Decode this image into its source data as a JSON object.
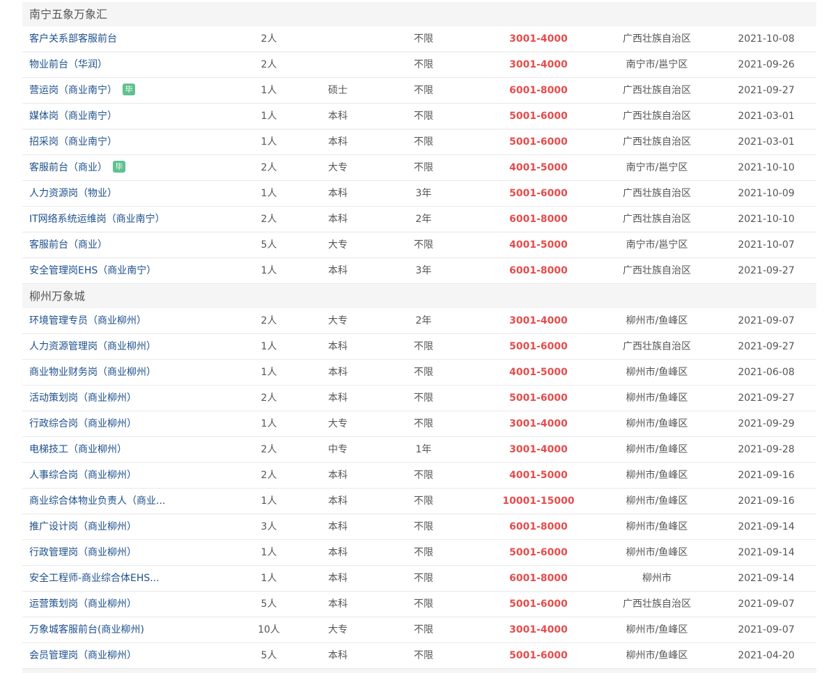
{
  "groups": [
    {
      "name": "南宁五象万象汇",
      "rows": [
        {
          "title": "客户关系部客服前台",
          "badge": "",
          "count": "2人",
          "education": "",
          "experience": "不限",
          "salary": "3001-4000",
          "location": "广西壮族自治区",
          "date": "2021-10-08"
        },
        {
          "title": "物业前台（华润）",
          "badge": "",
          "count": "2人",
          "education": "",
          "experience": "不限",
          "salary": "3001-4000",
          "location": "南宁市/邕宁区",
          "date": "2021-09-26"
        },
        {
          "title": "营运岗（商业南宁）",
          "badge": "毕",
          "count": "1人",
          "education": "硕士",
          "experience": "不限",
          "salary": "6001-8000",
          "location": "广西壮族自治区",
          "date": "2021-09-27"
        },
        {
          "title": "媒体岗（商业南宁）",
          "badge": "",
          "count": "1人",
          "education": "本科",
          "experience": "不限",
          "salary": "5001-6000",
          "location": "广西壮族自治区",
          "date": "2021-03-01"
        },
        {
          "title": "招采岗（商业南宁）",
          "badge": "",
          "count": "1人",
          "education": "本科",
          "experience": "不限",
          "salary": "5001-6000",
          "location": "广西壮族自治区",
          "date": "2021-03-01"
        },
        {
          "title": "客服前台（商业）",
          "badge": "毕",
          "count": "2人",
          "education": "大专",
          "experience": "不限",
          "salary": "4001-5000",
          "location": "南宁市/邕宁区",
          "date": "2021-10-10"
        },
        {
          "title": "人力资源岗（物业）",
          "badge": "",
          "count": "1人",
          "education": "本科",
          "experience": "3年",
          "salary": "5001-6000",
          "location": "广西壮族自治区",
          "date": "2021-10-09"
        },
        {
          "title": "IT网络系统运维岗（商业南宁）",
          "badge": "",
          "count": "2人",
          "education": "本科",
          "experience": "2年",
          "salary": "6001-8000",
          "location": "广西壮族自治区",
          "date": "2021-10-10"
        },
        {
          "title": "客服前台（商业）",
          "badge": "",
          "count": "5人",
          "education": "大专",
          "experience": "不限",
          "salary": "4001-5000",
          "location": "南宁市/邕宁区",
          "date": "2021-10-07"
        },
        {
          "title": "安全管理岗EHS（商业南宁）",
          "badge": "",
          "count": "1人",
          "education": "本科",
          "experience": "3年",
          "salary": "6001-8000",
          "location": "广西壮族自治区",
          "date": "2021-09-27"
        }
      ]
    },
    {
      "name": "柳州万象城",
      "rows": [
        {
          "title": "环境管理专员（商业柳州）",
          "badge": "",
          "count": "2人",
          "education": "大专",
          "experience": "2年",
          "salary": "3001-4000",
          "location": "柳州市/鱼峰区",
          "date": "2021-09-07"
        },
        {
          "title": "人力资源管理岗（商业柳州）",
          "badge": "",
          "count": "1人",
          "education": "本科",
          "experience": "不限",
          "salary": "5001-6000",
          "location": "广西壮族自治区",
          "date": "2021-09-27"
        },
        {
          "title": "商业物业财务岗（商业柳州）",
          "badge": "",
          "count": "1人",
          "education": "本科",
          "experience": "不限",
          "salary": "4001-5000",
          "location": "柳州市/鱼峰区",
          "date": "2021-06-08"
        },
        {
          "title": "活动策划岗（商业柳州）",
          "badge": "",
          "count": "2人",
          "education": "本科",
          "experience": "不限",
          "salary": "5001-6000",
          "location": "柳州市/鱼峰区",
          "date": "2021-09-27"
        },
        {
          "title": "行政综合岗（商业柳州）",
          "badge": "",
          "count": "1人",
          "education": "大专",
          "experience": "不限",
          "salary": "3001-4000",
          "location": "柳州市/鱼峰区",
          "date": "2021-09-29"
        },
        {
          "title": "电梯技工（商业柳州）",
          "badge": "",
          "count": "2人",
          "education": "中专",
          "experience": "1年",
          "salary": "3001-4000",
          "location": "柳州市/鱼峰区",
          "date": "2021-09-28"
        },
        {
          "title": "人事综合岗（商业柳州）",
          "badge": "",
          "count": "2人",
          "education": "本科",
          "experience": "不限",
          "salary": "4001-5000",
          "location": "柳州市/鱼峰区",
          "date": "2021-09-16"
        },
        {
          "title": "商业综合体物业负责人（商业...",
          "badge": "",
          "count": "1人",
          "education": "本科",
          "experience": "不限",
          "salary": "10001-15000",
          "location": "柳州市/鱼峰区",
          "date": "2021-09-16"
        },
        {
          "title": "推广设计岗（商业柳州）",
          "badge": "",
          "count": "3人",
          "education": "本科",
          "experience": "不限",
          "salary": "6001-8000",
          "location": "柳州市/鱼峰区",
          "date": "2021-09-14"
        },
        {
          "title": "行政管理岗（商业柳州）",
          "badge": "",
          "count": "1人",
          "education": "本科",
          "experience": "不限",
          "salary": "5001-6000",
          "location": "柳州市/鱼峰区",
          "date": "2021-09-14"
        },
        {
          "title": "安全工程师-商业综合体EHS...",
          "badge": "",
          "count": "1人",
          "education": "本科",
          "experience": "不限",
          "salary": "6001-8000",
          "location": "柳州市",
          "date": "2021-09-14"
        },
        {
          "title": "运营策划岗（商业柳州）",
          "badge": "",
          "count": "5人",
          "education": "本科",
          "experience": "不限",
          "salary": "5001-6000",
          "location": "广西壮族自治区",
          "date": "2021-09-07"
        },
        {
          "title": "万象城客服前台(商业柳州)",
          "badge": "",
          "count": "10人",
          "education": "大专",
          "experience": "不限",
          "salary": "3001-4000",
          "location": "柳州市/鱼峰区",
          "date": "2021-09-07"
        },
        {
          "title": "会员管理岗（商业柳州）",
          "badge": "",
          "count": "5人",
          "education": "本科",
          "experience": "不限",
          "salary": "5001-6000",
          "location": "柳州市/鱼峰区",
          "date": "2021-04-20"
        }
      ]
    }
  ],
  "colors": {
    "title_link": "#1c4f8c",
    "salary": "#e64c4c",
    "badge": "#5fc28e",
    "group_header_bg": "#f5f5f5"
  },
  "icons": {
    "badge": "graduate-badge"
  }
}
